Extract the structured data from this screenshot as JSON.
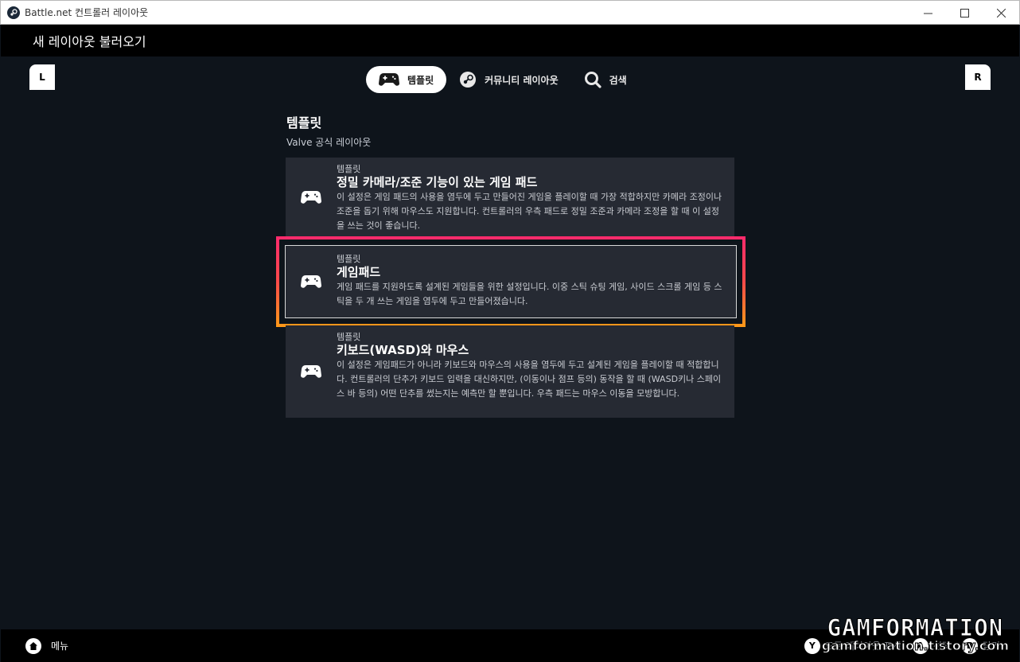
{
  "window": {
    "title": "Battle.net 컨트롤러 레이아웃"
  },
  "header": {
    "title": "새 레이아웃 불러오기"
  },
  "bumpers": {
    "left": "L",
    "right": "R"
  },
  "tabs": [
    {
      "label": "템플릿",
      "icon": "gamepad-icon",
      "active": true
    },
    {
      "label": "커뮤니티 레이아웃",
      "icon": "steam-icon",
      "active": false
    },
    {
      "label": "검색",
      "icon": "search-icon",
      "active": false
    }
  ],
  "section": {
    "title": "템플릿",
    "subtitle": "Valve 공식 레이아웃"
  },
  "templates": [
    {
      "tag": "템플릿",
      "name": "정밀 카메라/조준 기능이 있는 게임 패드",
      "description": "이 설정은 게임 패드의 사용을 염두에 두고 만들어진 게임을 플레이할 때 가장 적합하지만 카메라 조정이나 조준을 돕기 위해 마우스도 지원합니다. 컨트롤러의 우측 패드로 정밀 조준과 카메라 조정을 할 때 이 설정을 쓰는 것이 좋습니다."
    },
    {
      "tag": "템플릿",
      "name": "게임패드",
      "description": "게임 패드를 지원하도록 설계된 게임들을 위한 설정입니다. 이중 스틱 슈팅 게임, 사이드 스크롤 게임 등 스틱을 두 개 쓰는 게임을 염두에 두고 만들어졌습니다.",
      "selected": true
    },
    {
      "tag": "템플릿",
      "name": "키보드(WASD)와 마우스",
      "description": "이 설정은 게임패드가 아니라 키보드와 마우스의 사용을 염두에 두고 설계된 게임을 플레이할 때 적합합니다. 컨트롤러의 단추가 키보드 입력을 대신하지만, (이동이나 점프 등의) 동작을 할 때 (WASD키나 스페이스 바 등의) 어떤 단추를 썼는지는 예측만 할 뿐입니다. 우측 패드는 마우스 이동을 모방합니다."
    }
  ],
  "footer": {
    "menu_label": "메뉴",
    "hints": [
      {
        "button": "Y",
        "label": "모든 레이아웃 표시"
      },
      {
        "button": "A",
        "label": "선택"
      },
      {
        "button": "B",
        "label": "닫기"
      }
    ]
  },
  "watermark": {
    "line1": "GAMFORMATION",
    "line2": "gamformation.tistory.com"
  },
  "colors": {
    "background": "#0e141b",
    "card": "#262a33",
    "highlight_top": "#ff2a6d",
    "highlight_bottom": "#ff9a18"
  }
}
